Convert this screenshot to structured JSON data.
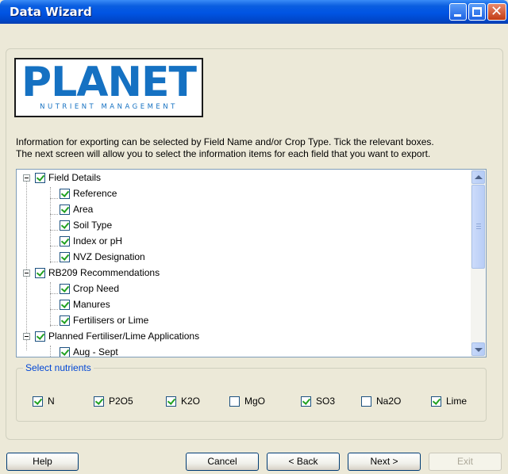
{
  "window": {
    "title": "Data Wizard"
  },
  "logo": {
    "brand": "PLANET",
    "tagline": "NUTRIENT MANAGEMENT"
  },
  "info": {
    "line1": "Information for exporting can be selected by Field Name and/or Crop Type. Tick the relevant boxes.",
    "line2": "The next screen will allow you to select the information items for each field that you want to export."
  },
  "tree": {
    "items": [
      {
        "label": "Field Details",
        "level": 0,
        "checked": true
      },
      {
        "label": "Reference",
        "level": 1,
        "checked": true
      },
      {
        "label": "Area",
        "level": 1,
        "checked": true
      },
      {
        "label": "Soil Type",
        "level": 1,
        "checked": true
      },
      {
        "label": "Index or pH",
        "level": 1,
        "checked": true
      },
      {
        "label": "NVZ Designation",
        "level": 1,
        "checked": true
      },
      {
        "label": "RB209 Recommendations",
        "level": 0,
        "checked": true
      },
      {
        "label": "Crop Need",
        "level": 1,
        "checked": true
      },
      {
        "label": "Manures",
        "level": 1,
        "checked": true
      },
      {
        "label": "Fertilisers or Lime",
        "level": 1,
        "checked": true
      },
      {
        "label": "Planned Fertiliser/Lime Applications",
        "level": 0,
        "checked": true
      },
      {
        "label": "Aug - Sept",
        "level": 1,
        "checked": true
      }
    ]
  },
  "nutrients": {
    "legend": "Select nutrients",
    "items": [
      {
        "label": "N",
        "checked": true
      },
      {
        "label": "P2O5",
        "checked": true
      },
      {
        "label": "K2O",
        "checked": true
      },
      {
        "label": "MgO",
        "checked": false
      },
      {
        "label": "SO3",
        "checked": true
      },
      {
        "label": "Na2O",
        "checked": false
      },
      {
        "label": "Lime",
        "checked": true
      }
    ]
  },
  "buttons": {
    "help": "Help",
    "cancel": "Cancel",
    "back": "< Back",
    "next": "Next >",
    "exit": "Exit"
  }
}
